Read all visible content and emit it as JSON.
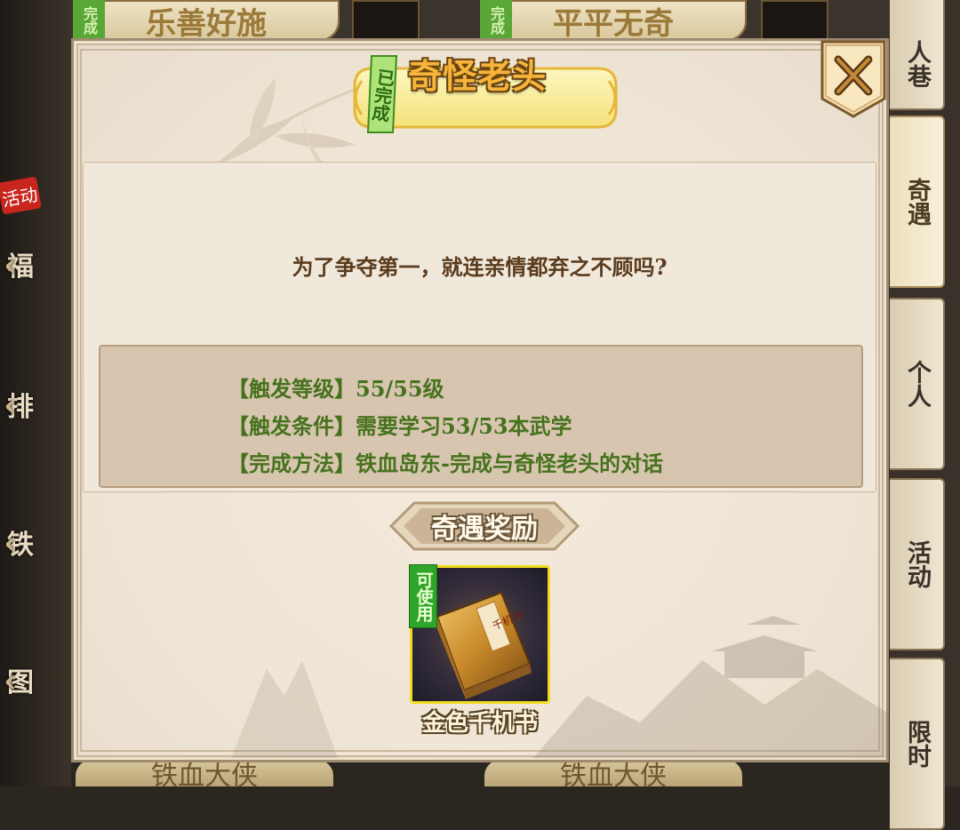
{
  "background": {
    "top_cards": [
      {
        "tag": "完成",
        "label": "乐善好施"
      },
      {
        "tag": "完成",
        "label": "平平无奇"
      }
    ],
    "left_nav": [
      {
        "badge": "活动",
        "label": "福"
      },
      {
        "label": "排"
      },
      {
        "label": "铁"
      },
      {
        "label": "图"
      }
    ],
    "right_tabs": [
      {
        "label": "人巷",
        "active": false
      },
      {
        "label": "奇遇",
        "active": true
      },
      {
        "label": "个人",
        "active": false
      },
      {
        "label": "活动",
        "active": false
      },
      {
        "label": "限时",
        "active": false
      }
    ],
    "bottom_cards": [
      "铁血大侠",
      "铁血大侠"
    ]
  },
  "dialog": {
    "done_badge": "已完成",
    "title": "奇怪老头",
    "question": "为了争夺第一，就连亲情都弃之不顾吗?",
    "conditions": [
      "【触发等级】55/55级",
      "【触发条件】需要学习53/53本武学",
      "【完成方法】铁血岛东-完成与奇怪老头的对话"
    ],
    "reward_header": "奇遇奖励",
    "reward_item": {
      "name": "金色千机书",
      "tag": "可使用",
      "icon": "golden-book-icon"
    },
    "close_icon": "close-x-icon"
  },
  "colors": {
    "title_text": "#f6b43a",
    "condition_text": "#46721d",
    "question_text": "#5a3b1c",
    "item_frame": "#f0dc1e",
    "usable_tag": "#2fa52a"
  }
}
